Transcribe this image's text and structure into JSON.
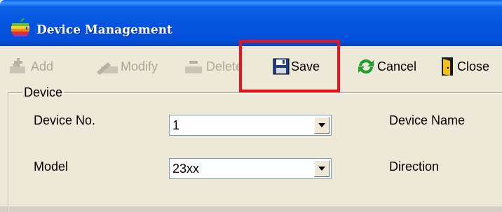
{
  "window": {
    "title": "Device Management",
    "title_icon": "apple-logo-icon"
  },
  "toolbar": {
    "add_label": "Add",
    "modify_label": "Modify",
    "delete_label": "Delete",
    "save_label": "Save",
    "cancel_label": "Cancel",
    "close_label": "Close",
    "disabled_items": [
      "Add",
      "Modify",
      "Delete"
    ],
    "highlighted_item": "Save",
    "highlight_color": "#e8141b"
  },
  "device_group": {
    "legend": "Device",
    "device_no_label": "Device No.",
    "device_no_value": "1",
    "model_label": "Model",
    "model_value": "23xx",
    "device_name_label": "Device Name",
    "direction_label": "Direction"
  },
  "colors": {
    "titlebar": "#0554e0",
    "window_bg": "#ece9d8",
    "disabled_text": "#aca899"
  }
}
